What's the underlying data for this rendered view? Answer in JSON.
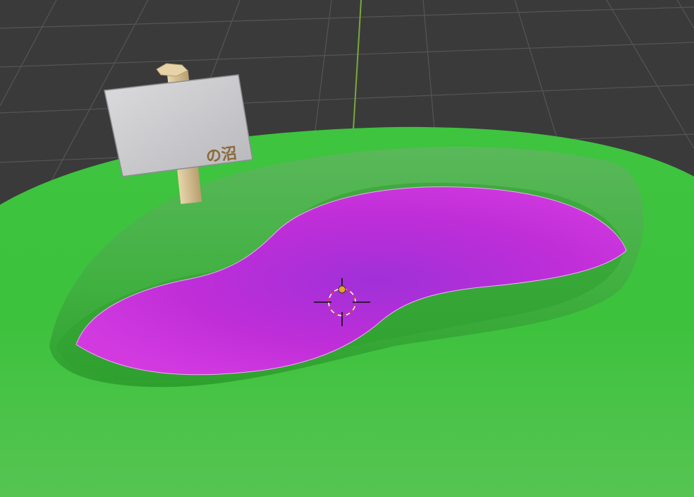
{
  "viewport": {
    "type": "3d-viewport",
    "background_color": "#3a3a3a",
    "grid_line_color": "#555555",
    "y_axis_color": "#7aa83a"
  },
  "scene": {
    "terrain": {
      "name": "grass-mound",
      "color": "#3fbf3f"
    },
    "pond": {
      "name": "pond-surface",
      "color": "#c832d8"
    },
    "sign": {
      "name": "signboard",
      "text": "の沼",
      "board_color": "#d2d2d4",
      "post_color": "#d8c49a"
    }
  },
  "cursor": {
    "name": "3d-cursor",
    "icon": "crosshair-icon",
    "ring_colors": [
      "#d03030",
      "#ffffff"
    ]
  }
}
